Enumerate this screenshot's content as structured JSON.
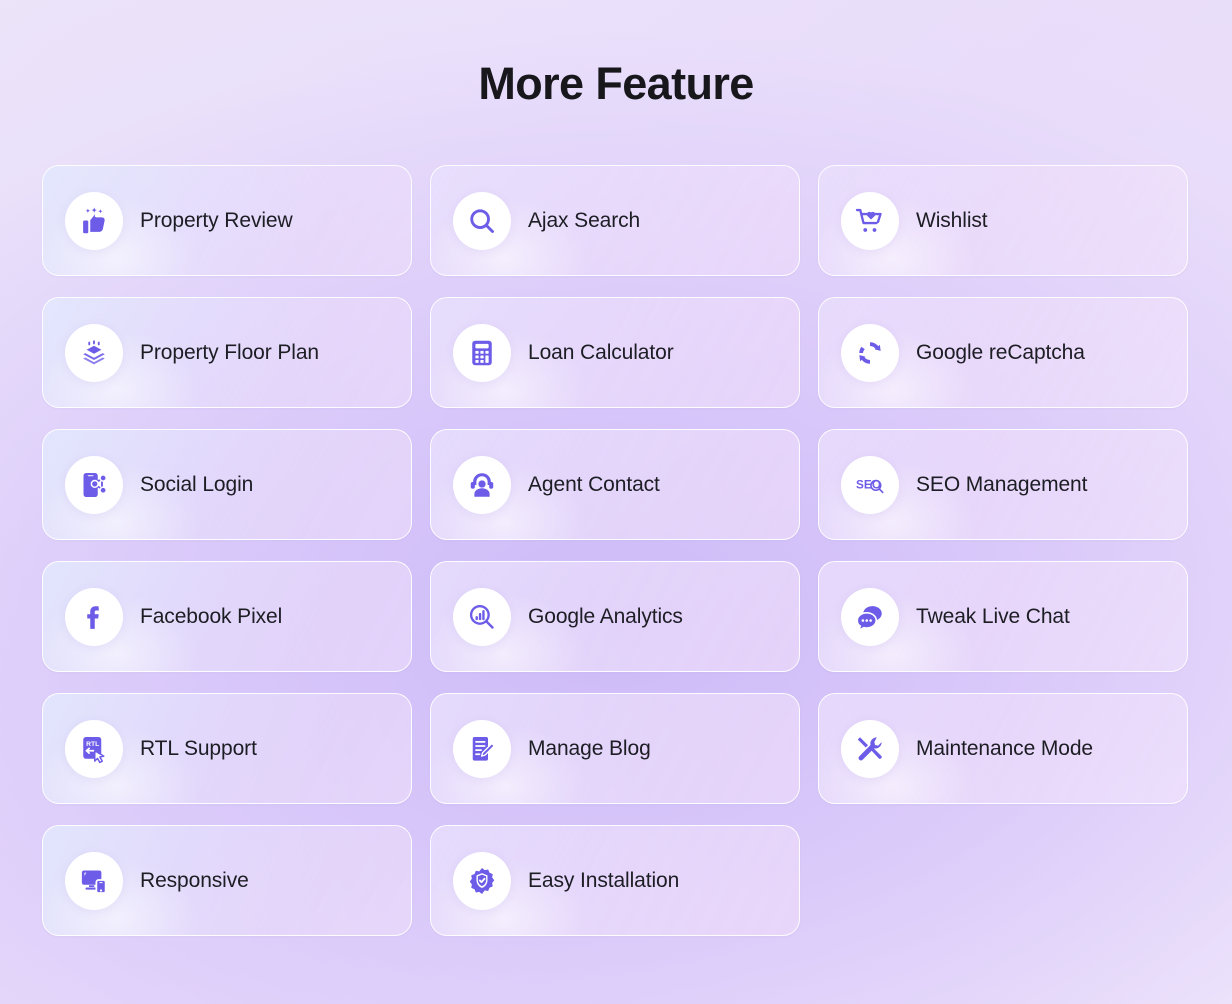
{
  "header": {
    "title": "More Feature"
  },
  "theme": {
    "accent": "#6C5CE7",
    "text": "#1D1D24",
    "title_color": "#17171C",
    "card_border": "#FFFFFF",
    "background_top_left": "#ECE5F9",
    "background_center": "#CFBDF5",
    "background_bottom_right": "#F3EBFC"
  },
  "features": [
    {
      "label": "Property Review",
      "icon": "thumbs-up-stars-icon",
      "column": 1,
      "row": 1
    },
    {
      "label": "Ajax Search",
      "icon": "magnifier-icon",
      "column": 2,
      "row": 1
    },
    {
      "label": "Wishlist",
      "icon": "cart-heart-icon",
      "column": 3,
      "row": 1
    },
    {
      "label": "Property Floor Plan",
      "icon": "layers-stack-icon",
      "column": 1,
      "row": 2
    },
    {
      "label": "Loan Calculator",
      "icon": "calculator-icon",
      "column": 2,
      "row": 2
    },
    {
      "label": "Google reCaptcha",
      "icon": "recaptcha-refresh-icon",
      "column": 3,
      "row": 2
    },
    {
      "label": "Social Login",
      "icon": "social-network-phone-icon",
      "column": 1,
      "row": 3
    },
    {
      "label": "Agent Contact",
      "icon": "headset-agent-icon",
      "column": 2,
      "row": 3
    },
    {
      "label": "SEO Management",
      "icon": "seo-magnifier-icon",
      "column": 3,
      "row": 3
    },
    {
      "label": "Facebook Pixel",
      "icon": "facebook-icon",
      "column": 1,
      "row": 4
    },
    {
      "label": "Google Analytics",
      "icon": "analytics-magnifier-icon",
      "column": 2,
      "row": 4
    },
    {
      "label": "Tweak Live Chat",
      "icon": "chat-bubbles-icon",
      "column": 3,
      "row": 4
    },
    {
      "label": "RTL Support",
      "icon": "rtl-cursor-icon",
      "column": 1,
      "row": 5
    },
    {
      "label": "Manage Blog",
      "icon": "document-pencil-icon",
      "column": 2,
      "row": 5
    },
    {
      "label": "Maintenance Mode",
      "icon": "wrench-screwdriver-icon",
      "column": 3,
      "row": 5
    },
    {
      "label": "Responsive",
      "icon": "monitor-phone-icon",
      "column": 1,
      "row": 6
    },
    {
      "label": "Easy Installation",
      "icon": "gear-check-icon",
      "column": 2,
      "row": 6
    }
  ],
  "icon_labels": {
    "seo": "SEO",
    "rtl": "RTL"
  }
}
